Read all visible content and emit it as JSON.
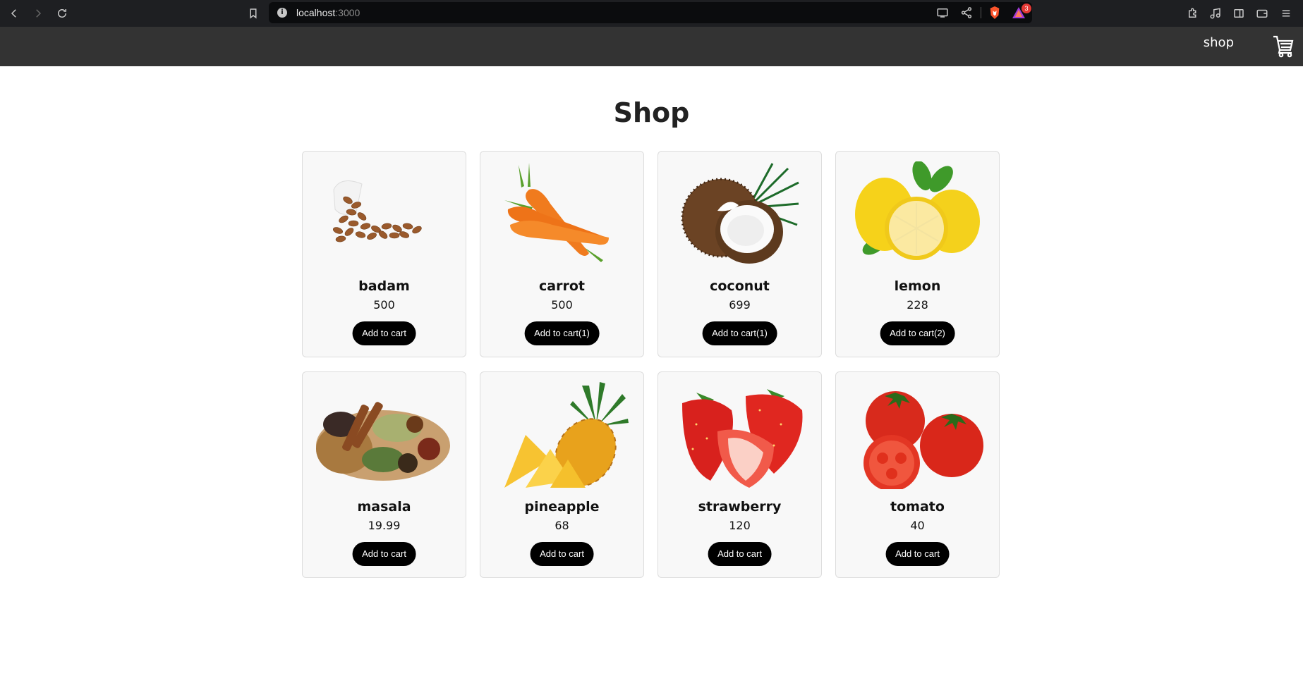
{
  "browser": {
    "url_host": "localhost",
    "url_port": ":3000",
    "extension_badge": "3"
  },
  "nav": {
    "link_label": "shop",
    "cart_icon": "shopping-cart-icon"
  },
  "page": {
    "title": "Shop"
  },
  "products": [
    {
      "name": "badam",
      "price": "500",
      "button_label": "Add to cart",
      "image": "almonds-image"
    },
    {
      "name": "carrot",
      "price": "500",
      "button_label": "Add to cart(1)",
      "image": "carrots-image"
    },
    {
      "name": "coconut",
      "price": "699",
      "button_label": "Add to cart(1)",
      "image": "coconut-image"
    },
    {
      "name": "lemon",
      "price": "228",
      "button_label": "Add to cart(2)",
      "image": "lemons-image"
    },
    {
      "name": "masala",
      "price": "19.99",
      "button_label": "Add to cart",
      "image": "spices-image"
    },
    {
      "name": "pineapple",
      "price": "68",
      "button_label": "Add to cart",
      "image": "pineapple-image"
    },
    {
      "name": "strawberry",
      "price": "120",
      "button_label": "Add to cart",
      "image": "strawberries-image"
    },
    {
      "name": "tomato",
      "price": "40",
      "button_label": "Add to cart",
      "image": "tomatoes-image"
    }
  ]
}
